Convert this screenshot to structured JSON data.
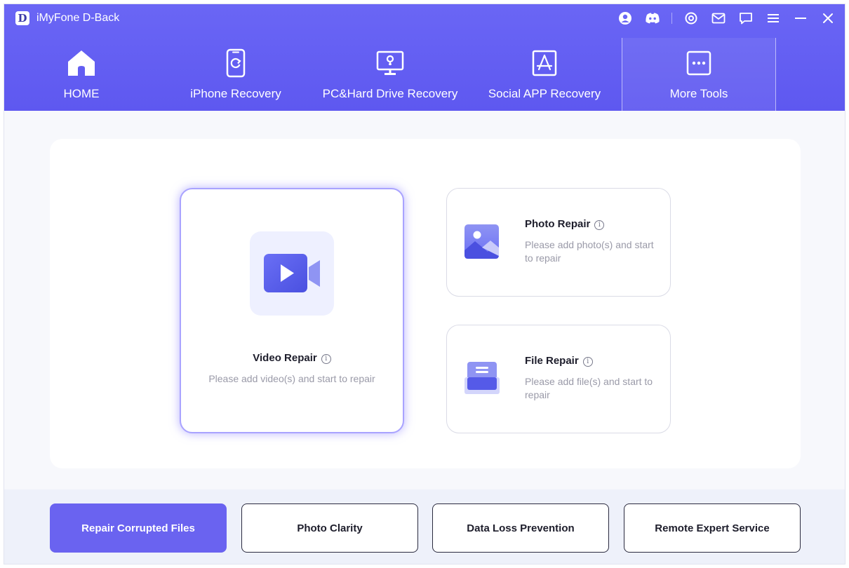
{
  "app": {
    "logo_letter": "D",
    "title": "iMyFone D-Back"
  },
  "titlebar_icons": [
    "account-icon",
    "discord-icon",
    "settings-icon",
    "mail-icon",
    "feedback-icon",
    "menu-icon",
    "minimize-icon",
    "close-icon"
  ],
  "nav": {
    "items": [
      {
        "label": "HOME",
        "icon": "home-icon"
      },
      {
        "label": "iPhone Recovery",
        "icon": "iphone-refresh-icon"
      },
      {
        "label": "PC&Hard Drive Recovery",
        "icon": "monitor-icon"
      },
      {
        "label": "Social APP Recovery",
        "icon": "app-store-icon"
      },
      {
        "label": "More Tools",
        "icon": "more-dots-icon",
        "active": true
      }
    ]
  },
  "cards": {
    "video": {
      "title": "Video Repair",
      "desc": "Please add video(s) and start to repair",
      "icon": "video-camera-icon"
    },
    "photo": {
      "title": "Photo Repair",
      "desc": "Please add photo(s) and start to repair",
      "icon": "photo-icon"
    },
    "file": {
      "title": "File Repair",
      "desc": "Please add file(s) and start to repair",
      "icon": "file-icon"
    }
  },
  "info_glyph": "i",
  "bottom_tabs": [
    {
      "label": "Repair Corrupted Files",
      "active": true
    },
    {
      "label": "Photo Clarity"
    },
    {
      "label": "Data Loss Prevention"
    },
    {
      "label": "Remote Expert Service"
    }
  ],
  "colors": {
    "header": "#6a66f5",
    "accent": "#6a63f0",
    "card_highlight": "#a9a3ff"
  }
}
